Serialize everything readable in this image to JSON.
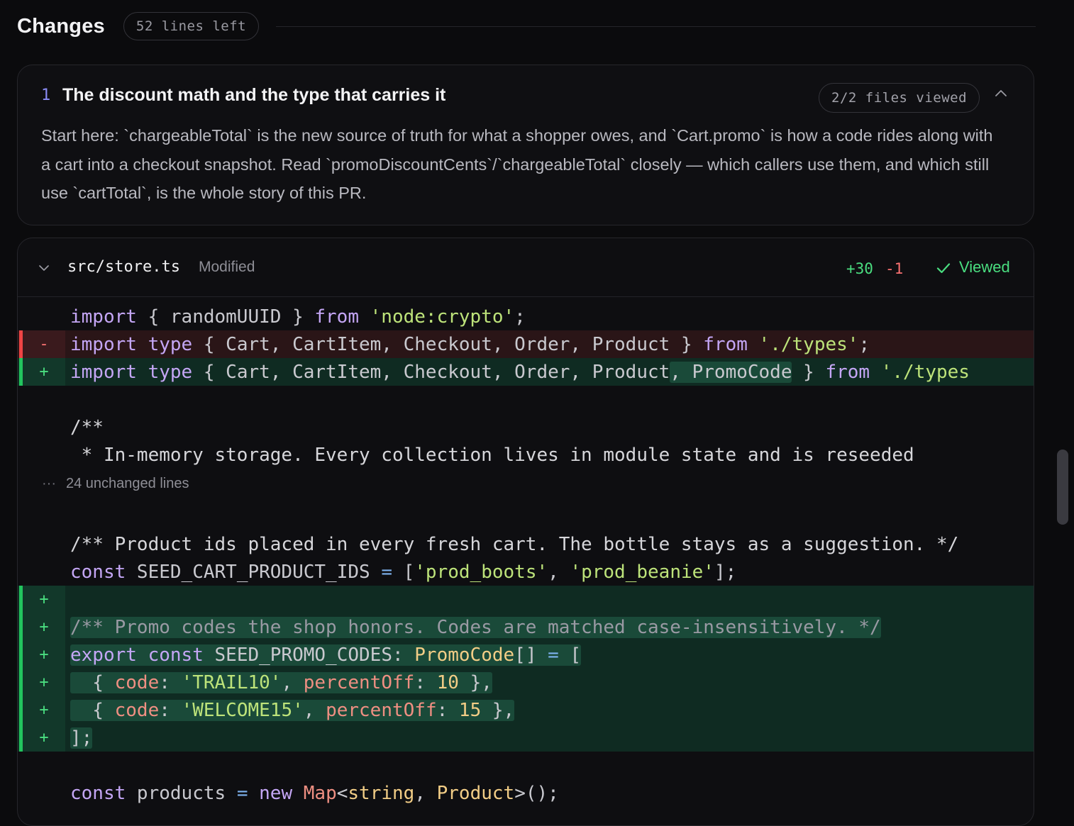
{
  "header": {
    "title": "Changes",
    "lines_left": "52 lines left"
  },
  "step": {
    "number": "1",
    "title": "The discount math and the type that carries it",
    "files_viewed": "2/2 files viewed",
    "description": "Start here: `chargeableTotal` is the new source of truth for what a shopper owes, and `Cart.promo` is how a code rides along with a cart into a checkout snapshot. Read `promoDiscountCents`/`chargeableTotal` closely — which callers use them, and which still use `cartTotal`, is the whole story of this PR."
  },
  "file": {
    "path": "src/store.ts",
    "status": "Modified",
    "additions": "+30",
    "deletions": "-1",
    "viewed_label": "Viewed",
    "fold_label": "24 unchanged lines",
    "fold_dots": "···",
    "marker_add": "+",
    "marker_del": "-"
  },
  "code": {
    "l1": {
      "kw_import": "import",
      "p1": " { randomUUID } ",
      "kw_from": "from",
      "sp": " ",
      "str": "'node:crypto'",
      "end": ";"
    },
    "l2": {
      "kw_import": "import",
      "sp1": " ",
      "kw_type": "type",
      "p1": " { Cart, CartItem, Checkout, Order, Product } ",
      "kw_from": "from",
      "sp2": " ",
      "str": "'./types'",
      "end": ";"
    },
    "l3": {
      "kw_import": "import",
      "sp1": " ",
      "kw_type": "type",
      "p1": " { Cart, CartItem, Checkout, Order, Product",
      "hl": ", PromoCode",
      "p2": " } ",
      "kw_from": "from",
      "sp2": " ",
      "str": "'./types"
    },
    "l5": "/**",
    "l6": " * In-memory storage. Every collection lives in module state and is reseeded",
    "l8": "/** Product ids placed in every fresh cart. The bottle stays as a suggestion. */",
    "l9": {
      "kw": "const",
      "name": " SEED_CART_PRODUCT_IDS ",
      "op": "=",
      "p1": " [",
      "s1": "'prod_boots'",
      "c": ", ",
      "s2": "'prod_beanie'",
      "end": "];"
    },
    "l11": "/** Promo codes the shop honors. Codes are matched case-insensitively. */",
    "l12": {
      "kw1": "export",
      "sp": " ",
      "kw2": "const",
      "name": " SEED_PROMO_CODES: ",
      "ty": "PromoCode",
      "p1": "[] ",
      "op": "=",
      "p2": " ["
    },
    "l13": {
      "p1": "  { ",
      "k1": "code",
      "c1": ": ",
      "s": "'TRAIL10'",
      "c2": ", ",
      "k2": "percentOff",
      "c3": ": ",
      "n": "10",
      "end": " },"
    },
    "l14": {
      "p1": "  { ",
      "k1": "code",
      "c1": ": ",
      "s": "'WELCOME15'",
      "c2": ", ",
      "k2": "percentOff",
      "c3": ": ",
      "n": "15",
      "end": " },"
    },
    "l15": "];",
    "l17": {
      "kw": "const",
      "name": " products ",
      "op": "=",
      "sp": " ",
      "kw2": "new",
      "sp2": " ",
      "ty1": "Map",
      "p1": "<",
      "ty2": "string",
      "p2": ", ",
      "ty3": "Product",
      "end": ">();"
    }
  }
}
